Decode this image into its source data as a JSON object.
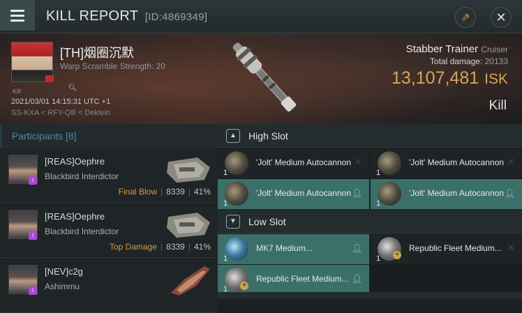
{
  "header": {
    "title": "KILL REPORT",
    "id": "[ID:4869349]"
  },
  "victim": {
    "name": "[TH]烟圈沉默",
    "warp_scramble": "Warp Scramble Strength: 20",
    "kill_tag": "Kill",
    "date": "2021/03/01 14:15:31 UTC +1",
    "location": "SS-KXA < RFY-QB < Deklein",
    "ship": "Stabber Trainer",
    "ship_class": "Cruiser",
    "total_damage_label": "Total damage:",
    "total_damage": "20133",
    "isk_value": "13,107,481",
    "isk_unit": "ISK",
    "result": "Kill"
  },
  "participants": {
    "header": "Participants [8]",
    "rows": [
      {
        "name": "[REAS]Oephre",
        "ship": "Blackbird Interdictor",
        "tag": "Final Blow",
        "damage": "8339",
        "percent": "41%"
      },
      {
        "name": "[REAS]Oephre",
        "ship": "Blackbird Interdictor",
        "tag": "Top Damage",
        "damage": "8339",
        "percent": "41%"
      },
      {
        "name": "[NEV]c2g",
        "ship": "Ashimmu",
        "tag": "",
        "damage": "",
        "percent": ""
      }
    ]
  },
  "slots": {
    "high": {
      "label": "High Slot",
      "modules": [
        {
          "qty": "1",
          "name": "'Jolt' Medium Autocannon"
        },
        {
          "qty": "1",
          "name": "'Jolt' Medium Autocannon"
        },
        {
          "qty": "1",
          "name": "'Jolt' Medium Autocannon"
        },
        {
          "qty": "1",
          "name": "'Jolt' Medium Autocannon"
        }
      ]
    },
    "low": {
      "label": "Low Slot",
      "modules": [
        {
          "qty": "1",
          "name": "MK7 Medium..."
        },
        {
          "qty": "1",
          "name": "Republic Fleet Medium..."
        },
        {
          "qty": "1",
          "name": "Republic Fleet Medium..."
        }
      ]
    }
  }
}
